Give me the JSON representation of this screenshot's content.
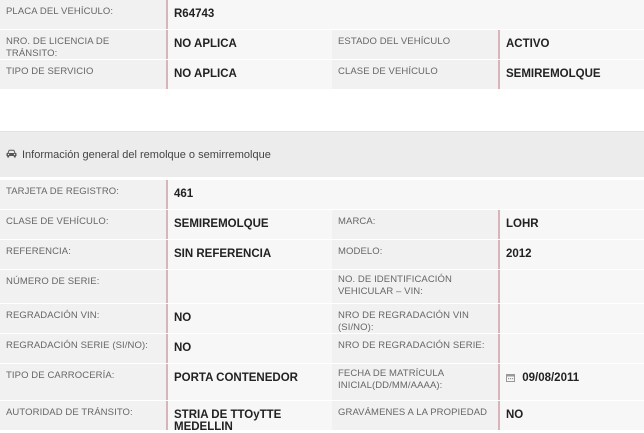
{
  "vehicle": {
    "placa_label": "PLACA DEL VEHÍCULO:",
    "placa_value": "R64743",
    "licencia_label": "NRO. DE LICENCIA DE TRÁNSITO:",
    "licencia_value": "NO APLICA",
    "estado_label": "ESTADO DEL VEHÍCULO",
    "estado_value": "ACTIVO",
    "servicio_label": "TIPO DE SERVICIO",
    "servicio_value": "NO APLICA",
    "clase_label": "CLASE DE VEHÍCULO",
    "clase_value": "SEMIREMOLQUE"
  },
  "section": {
    "title": "Información general del remolque o semirremolque",
    "icon": "car-icon"
  },
  "trailer": {
    "tarjeta_label": "TARJETA DE REGISTRO:",
    "tarjeta_value": "461",
    "clase_label": "CLASE DE VEHÍCULO:",
    "clase_value": "SEMIREMOLQUE",
    "marca_label": "MARCA:",
    "marca_value": "LOHR",
    "referencia_label": "REFERENCIA:",
    "referencia_value": "SIN REFERENCIA",
    "modelo_label": "MODELO:",
    "modelo_value": "2012",
    "serie_label": "NÚMERO DE SERIE:",
    "serie_value": "",
    "vin_label": "NO. DE IDENTIFICACIÓN VEHICULAR – VIN:",
    "vin_value": "",
    "regrab_vin_label": "REGRADACIÓN VIN:",
    "regrab_vin_value": "NO",
    "nro_regrab_vin_label": "NRO DE REGRADACIÓN VIN (SI/NO):",
    "nro_regrab_vin_value": "",
    "regrab_serie_label": "REGRADACIÓN SERIE (SI/NO):",
    "regrab_serie_value": "NO",
    "nro_regrab_serie_label": "NRO DE REGRADACIÓN SERIE:",
    "nro_regrab_serie_value": "",
    "carroceria_label": "TIPO DE CARROCERÍA:",
    "carroceria_value": "PORTA CONTENEDOR",
    "fecha_label": "FECHA DE MATRÍCULA INICIAL(DD/MM/AAAA):",
    "fecha_value": "09/08/2011",
    "autoridad_label": "AUTORIDAD DE TRÁNSITO:",
    "autoridad_value": "STRIA DE TTOyTTE MEDELLIN",
    "gravamenes_label": "GRAVÁMENES A LA PROPIEDAD",
    "gravamenes_value": "NO"
  }
}
